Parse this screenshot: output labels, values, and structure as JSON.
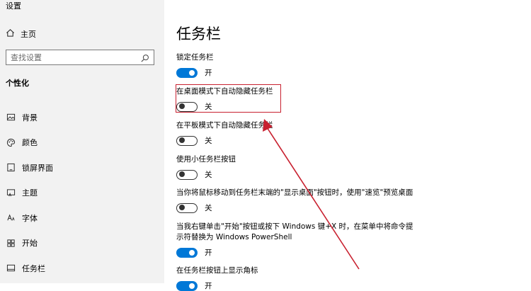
{
  "app": {
    "title": "设置"
  },
  "sidebar": {
    "home_label": "主页",
    "search_placeholder": "查找设置",
    "section": "个性化",
    "items": [
      {
        "label": "背景",
        "icon": "image-icon"
      },
      {
        "label": "颜色",
        "icon": "palette-icon"
      },
      {
        "label": "锁屏界面",
        "icon": "lock-screen-icon"
      },
      {
        "label": "主题",
        "icon": "theme-icon"
      },
      {
        "label": "字体",
        "icon": "font-icon"
      },
      {
        "label": "开始",
        "icon": "start-icon"
      },
      {
        "label": "任务栏",
        "icon": "taskbar-icon"
      }
    ]
  },
  "main": {
    "title": "任务栏",
    "settings": [
      {
        "label": "锁定任务栏",
        "state": "开",
        "on": true
      },
      {
        "label": "在桌面模式下自动隐藏任务栏",
        "state": "关",
        "on": false
      },
      {
        "label": "在平板模式下自动隐藏任务栏",
        "state": "关",
        "on": false
      },
      {
        "label": "使用小任务栏按钮",
        "state": "关",
        "on": false
      },
      {
        "label": "当你将鼠标移动到任务栏末端的\"显示桌面\"按钮时，使用\"速览\"预览桌面",
        "state": "关",
        "on": false
      },
      {
        "label": "当我右键单击\"开始\"按钮或按下 Windows 键+X 时，在菜单中将命令提示符替换为 Windows PowerShell",
        "state": "开",
        "on": true
      },
      {
        "label": "在任务栏按钮上显示角标",
        "state": "开",
        "on": true
      }
    ]
  },
  "colors": {
    "accent": "#0078d7",
    "annotation": "#c8202f",
    "sidebar_bg": "#f2f2f2"
  }
}
